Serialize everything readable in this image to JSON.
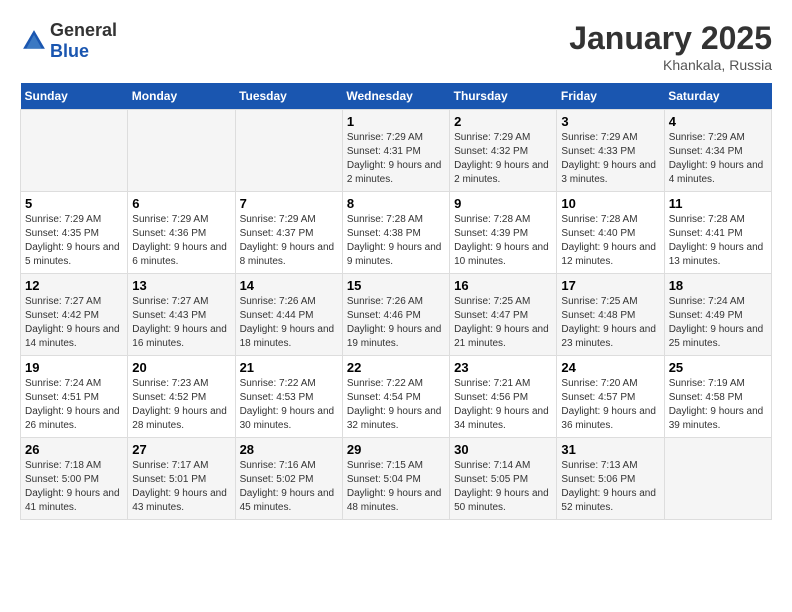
{
  "header": {
    "logo_general": "General",
    "logo_blue": "Blue",
    "month_title": "January 2025",
    "location": "Khankala, Russia"
  },
  "days_of_week": [
    "Sunday",
    "Monday",
    "Tuesday",
    "Wednesday",
    "Thursday",
    "Friday",
    "Saturday"
  ],
  "weeks": [
    [
      {
        "day": null,
        "info": ""
      },
      {
        "day": null,
        "info": ""
      },
      {
        "day": null,
        "info": ""
      },
      {
        "day": "1",
        "info": "Sunrise: 7:29 AM\nSunset: 4:31 PM\nDaylight: 9 hours and 2 minutes."
      },
      {
        "day": "2",
        "info": "Sunrise: 7:29 AM\nSunset: 4:32 PM\nDaylight: 9 hours and 2 minutes."
      },
      {
        "day": "3",
        "info": "Sunrise: 7:29 AM\nSunset: 4:33 PM\nDaylight: 9 hours and 3 minutes."
      },
      {
        "day": "4",
        "info": "Sunrise: 7:29 AM\nSunset: 4:34 PM\nDaylight: 9 hours and 4 minutes."
      }
    ],
    [
      {
        "day": "5",
        "info": "Sunrise: 7:29 AM\nSunset: 4:35 PM\nDaylight: 9 hours and 5 minutes."
      },
      {
        "day": "6",
        "info": "Sunrise: 7:29 AM\nSunset: 4:36 PM\nDaylight: 9 hours and 6 minutes."
      },
      {
        "day": "7",
        "info": "Sunrise: 7:29 AM\nSunset: 4:37 PM\nDaylight: 9 hours and 8 minutes."
      },
      {
        "day": "8",
        "info": "Sunrise: 7:28 AM\nSunset: 4:38 PM\nDaylight: 9 hours and 9 minutes."
      },
      {
        "day": "9",
        "info": "Sunrise: 7:28 AM\nSunset: 4:39 PM\nDaylight: 9 hours and 10 minutes."
      },
      {
        "day": "10",
        "info": "Sunrise: 7:28 AM\nSunset: 4:40 PM\nDaylight: 9 hours and 12 minutes."
      },
      {
        "day": "11",
        "info": "Sunrise: 7:28 AM\nSunset: 4:41 PM\nDaylight: 9 hours and 13 minutes."
      }
    ],
    [
      {
        "day": "12",
        "info": "Sunrise: 7:27 AM\nSunset: 4:42 PM\nDaylight: 9 hours and 14 minutes."
      },
      {
        "day": "13",
        "info": "Sunrise: 7:27 AM\nSunset: 4:43 PM\nDaylight: 9 hours and 16 minutes."
      },
      {
        "day": "14",
        "info": "Sunrise: 7:26 AM\nSunset: 4:44 PM\nDaylight: 9 hours and 18 minutes."
      },
      {
        "day": "15",
        "info": "Sunrise: 7:26 AM\nSunset: 4:46 PM\nDaylight: 9 hours and 19 minutes."
      },
      {
        "day": "16",
        "info": "Sunrise: 7:25 AM\nSunset: 4:47 PM\nDaylight: 9 hours and 21 minutes."
      },
      {
        "day": "17",
        "info": "Sunrise: 7:25 AM\nSunset: 4:48 PM\nDaylight: 9 hours and 23 minutes."
      },
      {
        "day": "18",
        "info": "Sunrise: 7:24 AM\nSunset: 4:49 PM\nDaylight: 9 hours and 25 minutes."
      }
    ],
    [
      {
        "day": "19",
        "info": "Sunrise: 7:24 AM\nSunset: 4:51 PM\nDaylight: 9 hours and 26 minutes."
      },
      {
        "day": "20",
        "info": "Sunrise: 7:23 AM\nSunset: 4:52 PM\nDaylight: 9 hours and 28 minutes."
      },
      {
        "day": "21",
        "info": "Sunrise: 7:22 AM\nSunset: 4:53 PM\nDaylight: 9 hours and 30 minutes."
      },
      {
        "day": "22",
        "info": "Sunrise: 7:22 AM\nSunset: 4:54 PM\nDaylight: 9 hours and 32 minutes."
      },
      {
        "day": "23",
        "info": "Sunrise: 7:21 AM\nSunset: 4:56 PM\nDaylight: 9 hours and 34 minutes."
      },
      {
        "day": "24",
        "info": "Sunrise: 7:20 AM\nSunset: 4:57 PM\nDaylight: 9 hours and 36 minutes."
      },
      {
        "day": "25",
        "info": "Sunrise: 7:19 AM\nSunset: 4:58 PM\nDaylight: 9 hours and 39 minutes."
      }
    ],
    [
      {
        "day": "26",
        "info": "Sunrise: 7:18 AM\nSunset: 5:00 PM\nDaylight: 9 hours and 41 minutes."
      },
      {
        "day": "27",
        "info": "Sunrise: 7:17 AM\nSunset: 5:01 PM\nDaylight: 9 hours and 43 minutes."
      },
      {
        "day": "28",
        "info": "Sunrise: 7:16 AM\nSunset: 5:02 PM\nDaylight: 9 hours and 45 minutes."
      },
      {
        "day": "29",
        "info": "Sunrise: 7:15 AM\nSunset: 5:04 PM\nDaylight: 9 hours and 48 minutes."
      },
      {
        "day": "30",
        "info": "Sunrise: 7:14 AM\nSunset: 5:05 PM\nDaylight: 9 hours and 50 minutes."
      },
      {
        "day": "31",
        "info": "Sunrise: 7:13 AM\nSunset: 5:06 PM\nDaylight: 9 hours and 52 minutes."
      },
      {
        "day": null,
        "info": ""
      }
    ]
  ]
}
